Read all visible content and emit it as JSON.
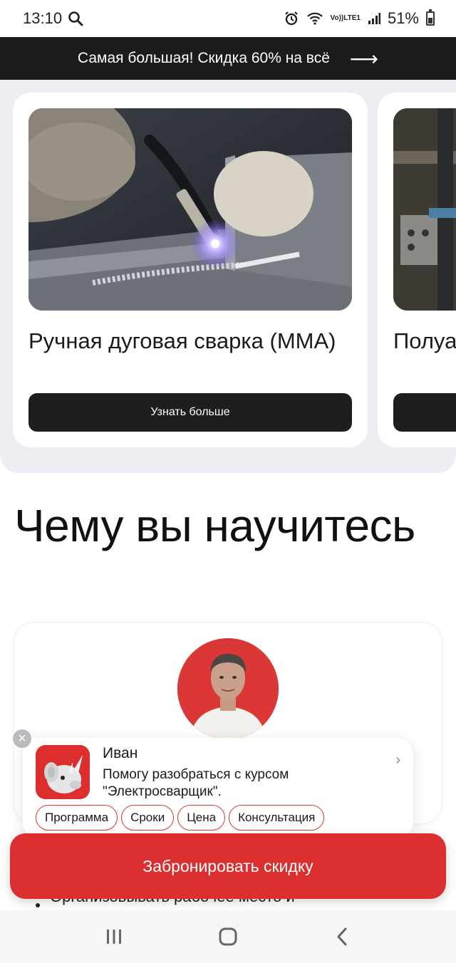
{
  "status_bar": {
    "time": "13:10",
    "battery": "51%",
    "network_label_top": "Vo))",
    "network_label_bottom": "LTE1"
  },
  "promo": {
    "text": "Самая большая! Скидка 60% на всё",
    "arrow": "⟶"
  },
  "courses": [
    {
      "title": "Ручная дуговая сварка (ММА)",
      "button": "Узнать больше"
    },
    {
      "title": "Полуа",
      "button": ""
    }
  ],
  "learn_section": {
    "title": "Чему вы научитесь"
  },
  "chat": {
    "name": "Иван",
    "message": "Помогу разобраться с курсом \"Электросварщик\".",
    "close": "×",
    "arrow": "›",
    "chips": [
      "Программа",
      "Сроки",
      "Цена",
      "Консультация"
    ]
  },
  "behind_list": {
    "item": "Организовывать рабочее место и"
  },
  "cta": {
    "label": "Забронировать скидку"
  },
  "colors": {
    "accent": "#dc3030",
    "dark": "#1c1c1c",
    "carousel_bg": "#eceef3"
  },
  "icons": {
    "search": "search-icon",
    "alarm": "alarm-icon",
    "wifi": "wifi-icon",
    "signal": "signal-icon",
    "battery": "battery-icon",
    "recent_apps": "recent-apps-icon",
    "home": "home-icon",
    "back": "back-icon"
  }
}
